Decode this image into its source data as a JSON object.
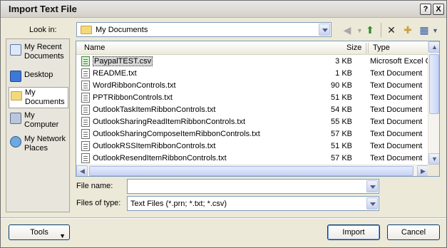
{
  "window": {
    "title": "Import Text File",
    "help_glyph": "?",
    "close_glyph": "X"
  },
  "lookin": {
    "label": "Look in:",
    "value": "My Documents"
  },
  "toolbar": {
    "back_glyph": "◀",
    "up_glyph": "⬆",
    "delete_glyph": "✕",
    "newfolder_glyph": "✚",
    "views_glyph": "▦"
  },
  "places": [
    {
      "label": "My Recent Documents",
      "icon": "recent-documents-icon"
    },
    {
      "label": "Desktop",
      "icon": "desktop-icon"
    },
    {
      "label": "My Documents",
      "icon": "my-documents-icon"
    },
    {
      "label": "My Computer",
      "icon": "my-computer-icon"
    },
    {
      "label": "My Network Places",
      "icon": "network-places-icon"
    }
  ],
  "columns": {
    "name": "Name",
    "size": "Size",
    "type": "Type"
  },
  "files": [
    {
      "name": "PaypalTEST.csv",
      "size": "3 KB",
      "type": "Microsoft Excel C"
    },
    {
      "name": "README.txt",
      "size": "1 KB",
      "type": "Text Document"
    },
    {
      "name": "WordRibbonControls.txt",
      "size": "90 KB",
      "type": "Text Document"
    },
    {
      "name": "PPTRibbonControls.txt",
      "size": "51 KB",
      "type": "Text Document"
    },
    {
      "name": "OutlookTaskItemRibbonControls.txt",
      "size": "54 KB",
      "type": "Text Document"
    },
    {
      "name": "OutlookSharingReadItemRibbonControls.txt",
      "size": "55 KB",
      "type": "Text Document"
    },
    {
      "name": "OutlookSharingComposeItemRibbonControls.txt",
      "size": "57 KB",
      "type": "Text Document"
    },
    {
      "name": "OutlookRSSItemRibbonControls.txt",
      "size": "51 KB",
      "type": "Text Document"
    },
    {
      "name": "OutlookResendItemRibbonControls.txt",
      "size": "57 KB",
      "type": "Text Document"
    }
  ],
  "filename": {
    "label": "File name:",
    "value": ""
  },
  "filetype": {
    "label": "Files of type:",
    "value": "Text Files (*.prn; *.txt; *.csv)"
  },
  "buttons": {
    "tools": "Tools",
    "import": "Import",
    "cancel": "Cancel"
  },
  "colors": {
    "window_bg": "#ece9d8",
    "border_blue": "#7f9db9",
    "button_border": "#003c74"
  }
}
